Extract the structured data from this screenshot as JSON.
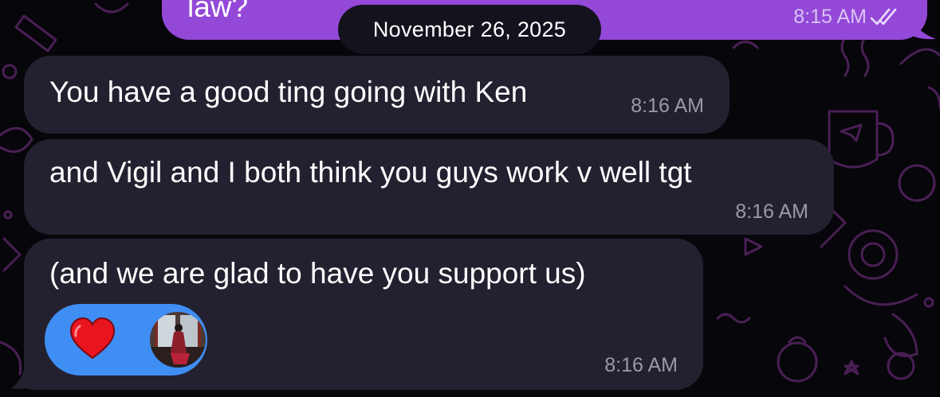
{
  "chat": {
    "outgoing_partial": {
      "text": "law?",
      "time": "8:15 AM",
      "status_icon": "double-check-icon",
      "color": "#9348d8"
    },
    "date_divider": "November 26, 2025",
    "messages": [
      {
        "text": "You have a good ting going with Ken",
        "time": "8:16 AM"
      },
      {
        "text": "and Vigil and I both think you guys work v well tgt",
        "time": "8:16 AM"
      },
      {
        "text": "(and we are glad to have you support us)",
        "time": "8:16 AM"
      }
    ],
    "reactions": [
      {
        "icon": "red-heart-icon",
        "color": "#e8151f"
      },
      {
        "icon": "reactor-avatar-icon"
      }
    ],
    "colors": {
      "incoming_bubble": "#232130",
      "reaction_pill": "#3f8ef4",
      "wallpaper_doodle": "#4a1f55"
    }
  }
}
